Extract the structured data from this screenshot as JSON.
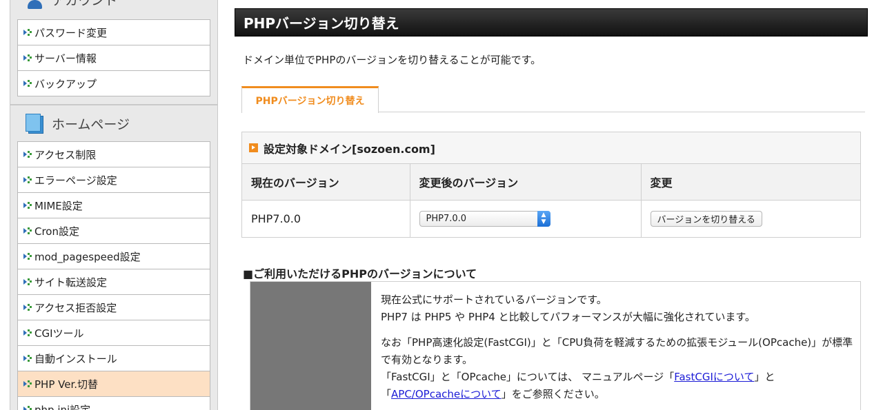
{
  "sidebar": {
    "account_section": {
      "title": "アカウント",
      "items": [
        {
          "label": "パスワード変更"
        },
        {
          "label": "サーバー情報"
        },
        {
          "label": "バックアップ"
        }
      ]
    },
    "home_section": {
      "title": "ホームページ",
      "items": [
        {
          "label": "アクセス制限"
        },
        {
          "label": "エラーページ設定"
        },
        {
          "label": "MIME設定"
        },
        {
          "label": "Cron設定"
        },
        {
          "label": "mod_pagespeed設定"
        },
        {
          "label": "サイト転送設定"
        },
        {
          "label": "アクセス拒否設定"
        },
        {
          "label": "CGIツール"
        },
        {
          "label": "自動インストール"
        },
        {
          "label": "PHP Ver.切替",
          "active": true
        },
        {
          "label": "php.ini設定"
        }
      ]
    }
  },
  "main": {
    "title": "PHPバージョン切り替え",
    "intro": "ドメイン単位でPHPのバージョンを切り替えることが可能です。",
    "tab_label": "PHPバージョン切り替え",
    "domain_heading": "設定対象ドメイン[sozoen.com]",
    "table": {
      "headers": [
        "現在のバージョン",
        "変更後のバージョン",
        "変更"
      ],
      "current_version": "PHP7.0.0",
      "select_value": "PHP7.0.0",
      "button_label": "バージョンを切り替える"
    },
    "available": {
      "heading": "■ご利用いただけるPHPのバージョンについて",
      "line1": "現在公式にサポートされているバージョンです。",
      "line2": "PHP7 は PHP5 や PHP4 と比較してパフォーマンスが大幅に強化されています。",
      "line3": "なお「PHP高速化設定(FastCGI)」と「CPU負荷を軽減するための拡張モジュール(OPcache)」が標準で有効となります。",
      "line4_a": "「FastCGI」と「OPcache」については、 マニュアルページ「",
      "link1": "FastCGIについて",
      "line4_b": "」と 「",
      "link2": "APC/OPcacheについて",
      "line4_c": "」をご参照ください。"
    }
  },
  "colors": {
    "accent_orange": "#f08c1e",
    "active_item_bg": "#fde0c4",
    "link": "#1a1ad6"
  }
}
